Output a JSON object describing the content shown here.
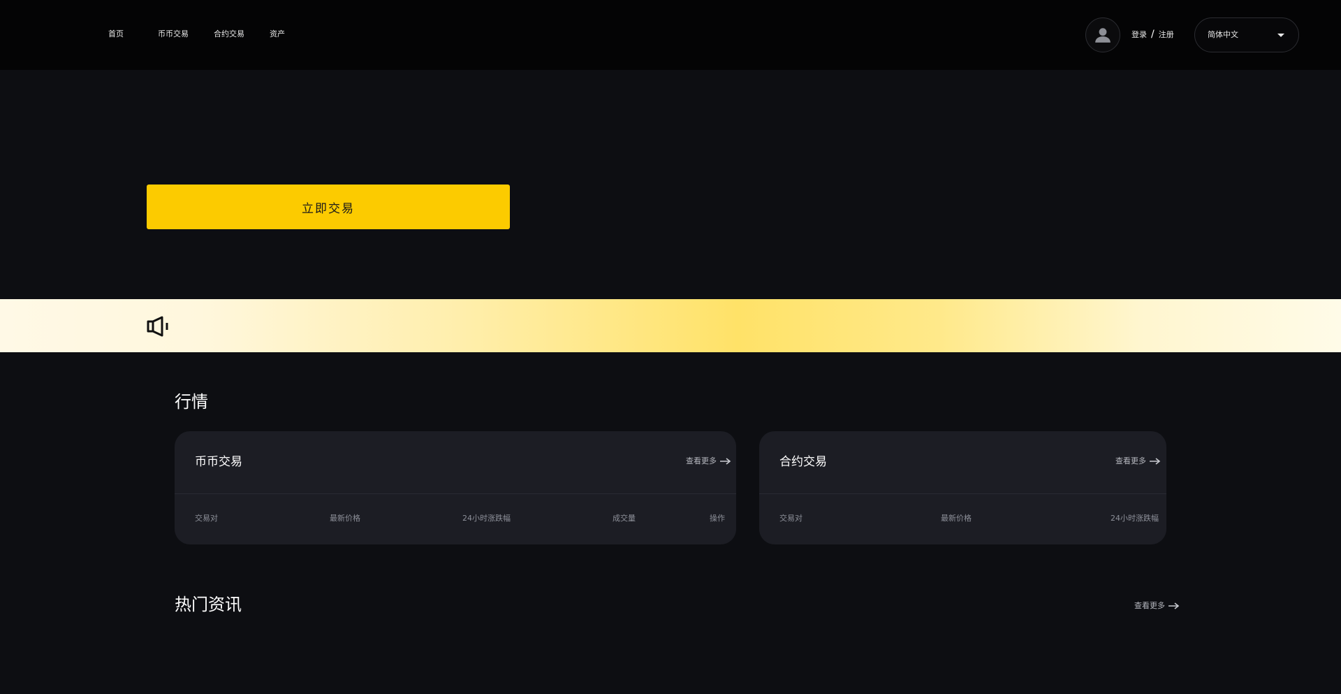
{
  "header": {
    "nav": [
      {
        "label": "首页"
      },
      {
        "label": "币币交易"
      },
      {
        "label": "合约交易"
      },
      {
        "label": "资产"
      }
    ],
    "auth": {
      "login": "登录",
      "separator": "/",
      "register": "注册"
    },
    "language": {
      "selected": "简体中文"
    }
  },
  "hero": {
    "cta_label": "立即交易"
  },
  "banner": {
    "icon": "speaker-icon"
  },
  "markets": {
    "title": "行情",
    "cards": [
      {
        "title": "币币交易",
        "more_label": "查看更多",
        "columns": [
          "交易对",
          "最新价格",
          "24小时涨跌幅",
          "成交量",
          "操作"
        ]
      },
      {
        "title": "合约交易",
        "more_label": "查看更多",
        "columns": [
          "交易对",
          "最新价格",
          "24小时涨跌幅"
        ]
      }
    ]
  },
  "section2": {
    "title": "热门资讯",
    "more_label": "查看更多"
  },
  "colors": {
    "accent": "#fccb00",
    "background": "#0d0e12",
    "header_bg": "#040405",
    "card_bg": "#1c1d24"
  }
}
